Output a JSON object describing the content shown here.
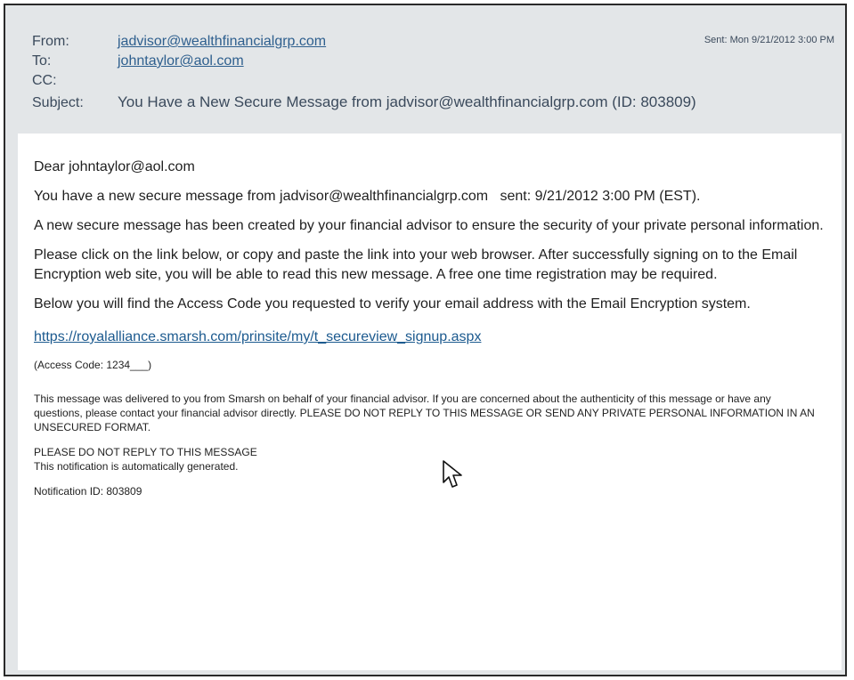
{
  "email": {
    "header": {
      "from_label": "From:",
      "from": "jadvisor@wealthfinancialgrp.com",
      "to_label": "To:",
      "to": "johntaylor@aol.com",
      "cc_label": "CC:",
      "subject_label": "Subject:",
      "subject": "You Have a New Secure Message from jadvisor@wealthfinancialgrp.com (ID: 803809)",
      "sent": "Sent: Mon 9/21/2012 3:00 PM"
    },
    "body": {
      "greeting": "Dear johntaylor@aol.com",
      "line1": "You have a new secure message from jadvisor@wealthfinancialgrp.com   sent: 9/21/2012 3:00 PM (EST).",
      "para1": "A new secure message has been created by your financial advisor to ensure the security of your private personal information.",
      "para2": "Please click on the link below, or copy and paste the link into your web browser. After successfully signing on to the Email Encryption web site, you will be able to read this new message. A free one time registration may be required.",
      "para3": "Below you will find the Access Code you requested to verify your email address with the Email Encryption system.",
      "link": "https://royalalliance.smarsh.com/prinsite/my/t_secureview_signup.aspx",
      "access_code": "(Access Code: 1234___)",
      "disclaimer": "This message was delivered to you from Smarsh on behalf of your financial advisor. If you are concerned about the authenticity of this message or have any questions, please contact your financial advisor directly. PLEASE DO NOT REPLY TO THIS MESSAGE OR SEND ANY PRIVATE PERSONAL INFORMATION IN AN UNSECURED FORMAT.",
      "noreply": "PLEASE DO NOT REPLY TO THIS MESSAGE",
      "auto": "This notification is automatically generated.",
      "notification_id": "Notification ID: 803809"
    }
  },
  "colors": {
    "header_bg": "#e3e6e8",
    "link": "#1c5a8f"
  },
  "icons": {
    "cursor": "mouse-pointer-icon"
  }
}
